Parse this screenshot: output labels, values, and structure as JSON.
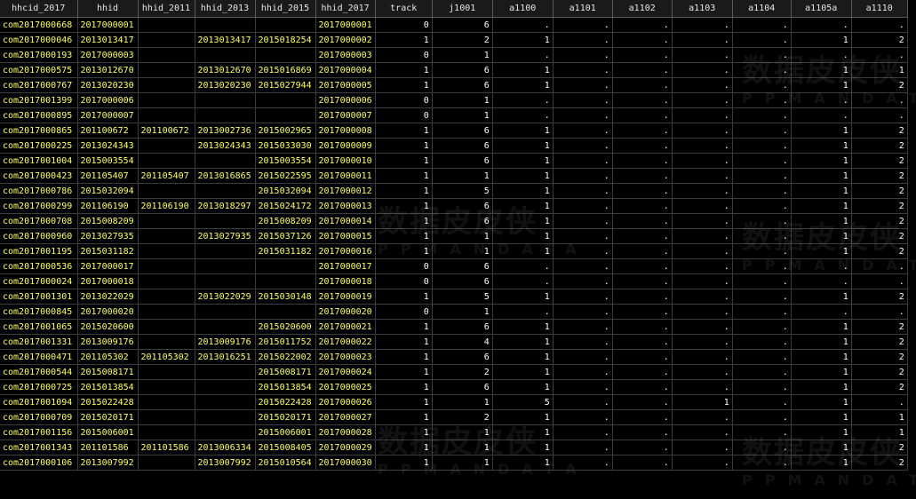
{
  "columns": [
    {
      "label": "hhcid_2017",
      "type": "str"
    },
    {
      "label": "hhid",
      "type": "str"
    },
    {
      "label": "hhid_2011",
      "type": "str"
    },
    {
      "label": "hhid_2013",
      "type": "str"
    },
    {
      "label": "hhid_2015",
      "type": "str"
    },
    {
      "label": "hhid_2017",
      "type": "str"
    },
    {
      "label": "track",
      "type": "num"
    },
    {
      "label": "j1001",
      "type": "num"
    },
    {
      "label": "a1100",
      "type": "num"
    },
    {
      "label": "a1101",
      "type": "num"
    },
    {
      "label": "a1102",
      "type": "num"
    },
    {
      "label": "a1103",
      "type": "num"
    },
    {
      "label": "a1104",
      "type": "num"
    },
    {
      "label": "a1105a",
      "type": "num"
    },
    {
      "label": "a1110",
      "type": "num"
    }
  ],
  "rows": [
    [
      "com2017000668",
      "2017000001",
      "",
      "",
      "",
      "2017000001",
      "0",
      "6",
      ".",
      ".",
      ".",
      ".",
      ".",
      ".",
      "."
    ],
    [
      "com2017000046",
      "2013013417",
      "",
      "2013013417",
      "2015018254",
      "2017000002",
      "1",
      "2",
      "1",
      ".",
      ".",
      ".",
      ".",
      "1",
      "2"
    ],
    [
      "com2017000193",
      "2017000003",
      "",
      "",
      "",
      "2017000003",
      "0",
      "1",
      ".",
      ".",
      ".",
      ".",
      ".",
      ".",
      "."
    ],
    [
      "com2017000575",
      "2013012670",
      "",
      "2013012670",
      "2015016869",
      "2017000004",
      "1",
      "6",
      "1",
      ".",
      ".",
      ".",
      ".",
      "1",
      "1"
    ],
    [
      "com2017000767",
      "2013020230",
      "",
      "2013020230",
      "2015027944",
      "2017000005",
      "1",
      "6",
      "1",
      ".",
      ".",
      ".",
      ".",
      "1",
      "2"
    ],
    [
      "com2017001399",
      "2017000006",
      "",
      "",
      "",
      "2017000006",
      "0",
      "1",
      ".",
      ".",
      ".",
      ".",
      ".",
      ".",
      "."
    ],
    [
      "com2017000895",
      "2017000007",
      "",
      "",
      "",
      "2017000007",
      "0",
      "1",
      ".",
      ".",
      ".",
      ".",
      ".",
      ".",
      "."
    ],
    [
      "com2017000865",
      "201100672",
      "201100672",
      "2013002736",
      "2015002965",
      "2017000008",
      "1",
      "6",
      "1",
      ".",
      ".",
      ".",
      ".",
      "1",
      "2"
    ],
    [
      "com2017000225",
      "2013024343",
      "",
      "2013024343",
      "2015033030",
      "2017000009",
      "1",
      "6",
      "1",
      ".",
      ".",
      ".",
      ".",
      "1",
      "2"
    ],
    [
      "com2017001004",
      "2015003554",
      "",
      "",
      "2015003554",
      "2017000010",
      "1",
      "6",
      "1",
      ".",
      ".",
      ".",
      ".",
      "1",
      "2"
    ],
    [
      "com2017000423",
      "201105407",
      "201105407",
      "2013016865",
      "2015022595",
      "2017000011",
      "1",
      "1",
      "1",
      ".",
      ".",
      ".",
      ".",
      "1",
      "2"
    ],
    [
      "com2017000786",
      "2015032094",
      "",
      "",
      "2015032094",
      "2017000012",
      "1",
      "5",
      "1",
      ".",
      ".",
      ".",
      ".",
      "1",
      "2"
    ],
    [
      "com2017000299",
      "201106190",
      "201106190",
      "2013018297",
      "2015024172",
      "2017000013",
      "1",
      "6",
      "1",
      ".",
      ".",
      ".",
      ".",
      "1",
      "2"
    ],
    [
      "com2017000708",
      "2015008209",
      "",
      "",
      "2015008209",
      "2017000014",
      "1",
      "6",
      "1",
      ".",
      ".",
      ".",
      ".",
      "1",
      "2"
    ],
    [
      "com2017000960",
      "2013027935",
      "",
      "2013027935",
      "2015037126",
      "2017000015",
      "1",
      "1",
      "1",
      ".",
      ".",
      ".",
      ".",
      "1",
      "2"
    ],
    [
      "com2017001195",
      "2015031182",
      "",
      "",
      "2015031182",
      "2017000016",
      "1",
      "1",
      "1",
      ".",
      ".",
      ".",
      ".",
      "1",
      "2"
    ],
    [
      "com2017000536",
      "2017000017",
      "",
      "",
      "",
      "2017000017",
      "0",
      "6",
      ".",
      ".",
      ".",
      ".",
      ".",
      ".",
      "."
    ],
    [
      "com2017000024",
      "2017000018",
      "",
      "",
      "",
      "2017000018",
      "0",
      "6",
      ".",
      ".",
      ".",
      ".",
      ".",
      ".",
      "."
    ],
    [
      "com2017001301",
      "2013022029",
      "",
      "2013022029",
      "2015030148",
      "2017000019",
      "1",
      "5",
      "1",
      ".",
      ".",
      ".",
      ".",
      "1",
      "2"
    ],
    [
      "com2017000845",
      "2017000020",
      "",
      "",
      "",
      "2017000020",
      "0",
      "1",
      ".",
      ".",
      ".",
      ".",
      ".",
      ".",
      "."
    ],
    [
      "com2017001065",
      "2015020600",
      "",
      "",
      "2015020600",
      "2017000021",
      "1",
      "6",
      "1",
      ".",
      ".",
      ".",
      ".",
      "1",
      "2"
    ],
    [
      "com2017001331",
      "2013009176",
      "",
      "2013009176",
      "2015011752",
      "2017000022",
      "1",
      "4",
      "1",
      ".",
      ".",
      ".",
      ".",
      "1",
      "2"
    ],
    [
      "com2017000471",
      "201105302",
      "201105302",
      "2013016251",
      "2015022002",
      "2017000023",
      "1",
      "6",
      "1",
      ".",
      ".",
      ".",
      ".",
      "1",
      "2"
    ],
    [
      "com2017000544",
      "2015008171",
      "",
      "",
      "2015008171",
      "2017000024",
      "1",
      "2",
      "1",
      ".",
      ".",
      ".",
      ".",
      "1",
      "2"
    ],
    [
      "com2017000725",
      "2015013854",
      "",
      "",
      "2015013854",
      "2017000025",
      "1",
      "6",
      "1",
      ".",
      ".",
      ".",
      ".",
      "1",
      "2"
    ],
    [
      "com2017001094",
      "2015022428",
      "",
      "",
      "2015022428",
      "2017000026",
      "1",
      "1",
      "5",
      ".",
      ".",
      "1",
      ".",
      "1",
      "."
    ],
    [
      "com2017000709",
      "2015020171",
      "",
      "",
      "2015020171",
      "2017000027",
      "1",
      "2",
      "1",
      ".",
      ".",
      ".",
      ".",
      "1",
      "1"
    ],
    [
      "com2017001156",
      "2015006001",
      "",
      "",
      "2015006001",
      "2017000028",
      "1",
      "1",
      "1",
      ".",
      ".",
      ".",
      ".",
      "1",
      "1"
    ],
    [
      "com2017001343",
      "201101586",
      "201101586",
      "2013006334",
      "2015008405",
      "2017000029",
      "1",
      "1",
      "1",
      ".",
      ".",
      ".",
      ".",
      "1",
      "2"
    ],
    [
      "com2017000106",
      "2013007992",
      "",
      "2013007992",
      "2015010564",
      "2017000030",
      "1",
      "1",
      "1",
      ".",
      ".",
      ".",
      ".",
      "1",
      "2"
    ]
  ],
  "watermark": {
    "title": "数据皮皮侠",
    "subtitle": "PPMANDATA"
  }
}
